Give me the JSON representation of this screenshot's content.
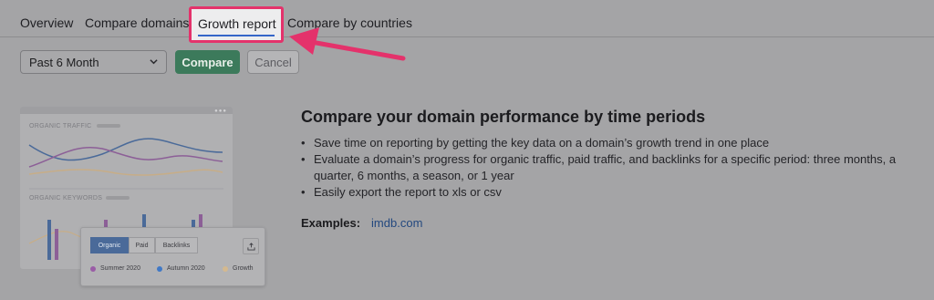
{
  "tabs": {
    "overview": "Overview",
    "compare_domains": "Compare domains",
    "growth_report": "Growth report",
    "compare_by_countries": "Compare by countries"
  },
  "controls": {
    "period_select": "Past 6 Month",
    "compare_label": "Compare",
    "cancel_label": "Cancel"
  },
  "preview": {
    "organic_traffic": "ORGANIC TRAFFIC",
    "organic_keywords": "ORGANIC KEYWORDS",
    "segments": [
      "Organic",
      "Paid",
      "Backlinks"
    ],
    "legend": [
      {
        "label": "Summer 2020",
        "color": "#9a5ca6"
      },
      {
        "label": "Autumn 2020",
        "color": "#3f78c6"
      },
      {
        "label": "Growth",
        "color": "#d4b98f"
      }
    ]
  },
  "content": {
    "heading": "Compare your domain performance by time periods",
    "bullets": [
      "Save time on reporting by getting the key data on a domain’s growth trend in one place",
      "Evaluate a domain’s progress for organic traffic, paid traffic, and backlinks for a specific period: three months, a quarter, 6 months, a season, or 1 year",
      "Easily export the report to xls or csv"
    ],
    "examples_label": "Examples:",
    "examples_link": "imdb.com"
  },
  "colors": {
    "accent_highlight": "#e4326b",
    "compare_button": "#3c7a5b",
    "tab_underline": "#3566c8"
  }
}
